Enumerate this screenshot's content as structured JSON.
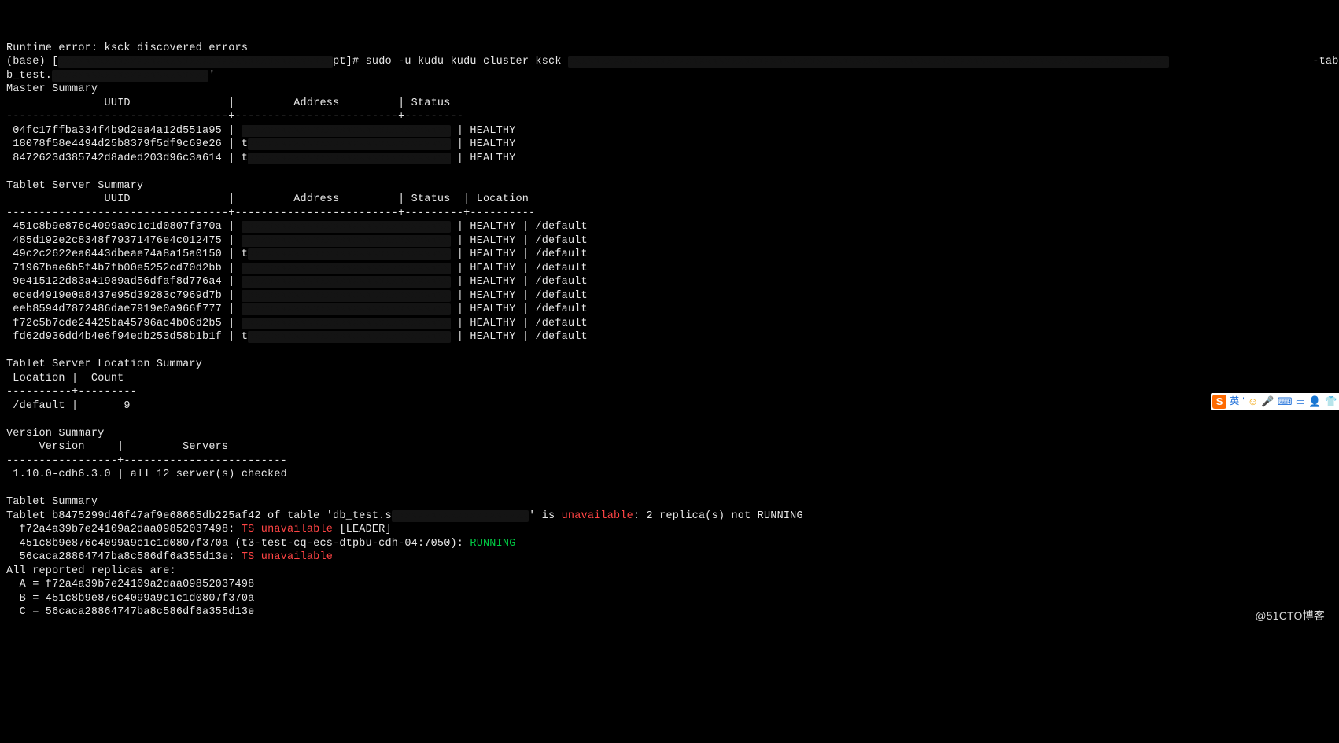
{
  "line0": "Runtime error: ksck discovered errors",
  "prompt": {
    "prefix": "(base) [",
    "host_redacted": "xxxxxxxxxxxxxxxxxxxxxxxxxxxxxxxxxxxxxxxxxx",
    "suffix": "pt]# ",
    "cmd": "sudo -u kudu kudu cluster ksck ",
    "args_redacted": "xxxxxxxxxxxxxxxxxxxxxxxxxxxxxxxxxxxxxxxxxxxxxxxxxxxxxxxxxxxxxxxxxxxxxxxxxxxxxxxxxxxxxxxxxxxx",
    "tail": "                      -tables='d",
    "line2a": "b_test.",
    "line2_redacted": "xxxxxxxxxxxxxxxxxxxxxxxx",
    "line2b": "'"
  },
  "master": {
    "title": "Master Summary",
    "header": "               UUID               |         Address         | Status",
    "sep": "----------------------------------+-------------------------+---------",
    "rows": [
      {
        "uuid": " 04fc17ffba334f4b9d2ea4a12d551a95 | ",
        "addr": "xxxxxxxxxxxxxxxxxxxxxxxxxxxxxxxx",
        "tail": " | HEALTHY"
      },
      {
        "uuid": " 18078f58e4494d25b8379f5df9c69e26 | t",
        "addr": "xxxxxxxxxxxxxxxxxxxxxxxxxxxxxxx",
        "tail": " | HEALTHY"
      },
      {
        "uuid": " 8472623d385742d8aded203d96c3a614 | t",
        "addr": "xxxxxxxxxxxxxxxxxxxxxxxxxxxxxxx",
        "tail": " | HEALTHY"
      }
    ]
  },
  "tserver": {
    "title": "Tablet Server Summary",
    "header": "               UUID               |         Address         | Status  | Location",
    "sep": "----------------------------------+-------------------------+---------+----------",
    "rows": [
      {
        "uuid": " 451c8b9e876c4099a9c1c1d0807f370a | ",
        "addr": "xxxxxxxxxxxxxxxxxxxxxxxxxxxxxxxx",
        "tail": " | HEALTHY | /default"
      },
      {
        "uuid": " 485d192e2c8348f79371476e4c012475 | ",
        "addr": "xxxxxxxxxxxxxxxxxxxxxxxxxxxxxxxx",
        "tail": " | HEALTHY | /default"
      },
      {
        "uuid": " 49c2c2622ea0443dbeae74a8a15a0150 | t",
        "addr": "xxxxxxxxxxxxxxxxxxxxxxxxxxxxxxx",
        "tail": " | HEALTHY | /default"
      },
      {
        "uuid": " 71967bae6b5f4b7fb00e5252cd70d2bb | ",
        "addr": "xxxxxxxxxxxxxxxxxxxxxxxxxxxxxxxx",
        "tail": " | HEALTHY | /default"
      },
      {
        "uuid": " 9e415122d83a41989ad56dfaf8d776a4 | ",
        "addr": "xxxxxxxxxxxxxxxxxxxxxxxxxxxxxxxx",
        "tail": " | HEALTHY | /default"
      },
      {
        "uuid": " eced4919e0a8437e95d39283c7969d7b | ",
        "addr": "xxxxxxxxxxxxxxxxxxxxxxxxxxxxxxxx",
        "tail": " | HEALTHY | /default"
      },
      {
        "uuid": " eeb8594d7872486dae7919e0a966f777 | ",
        "addr": "xxxxxxxxxxxxxxxxxxxxxxxxxxxxxxxx",
        "tail": " | HEALTHY | /default"
      },
      {
        "uuid": " f72c5b7cde24425ba45796ac4b06d2b5 | ",
        "addr": "xxxxxxxxxxxxxxxxxxxxxxxxxxxxxxxx",
        "tail": " | HEALTHY | /default"
      },
      {
        "uuid": " fd62d936dd4b4e6f94edb253d58b1b1f | t",
        "addr": "xxxxxxxxxxxxxxxxxxxxxxxxxxxxxxx",
        "tail": " | HEALTHY | /default"
      }
    ]
  },
  "location": {
    "title": "Tablet Server Location Summary",
    "header": " Location |  Count",
    "sep": "----------+---------",
    "row": " /default |       9"
  },
  "version": {
    "title": "Version Summary",
    "header": "     Version     |         Servers",
    "sep": "-----------------+-------------------------",
    "row": " 1.10.0-cdh6.3.0 | all 12 server(s) checked"
  },
  "tablet": {
    "title": "Tablet Summary",
    "l1a": "Tablet b8475299d46f47af9e68665db225af42 of table 'db_test.s",
    "l1_redacted": "xxxxxxxxxxxxxxxxxxxxx",
    "l1b": "' is ",
    "l1_unavailable": "unavailable",
    "l1c": ": 2 replica(s) not RUNNING",
    "l2a": "  f72a4a39b7e24109a2daa09852037498: ",
    "l2_ts": "TS unavailable",
    "l2b": " [LEADER]",
    "l3a": "  451c8b9e876c4099a9c1c1d0807f370a (t3-test-cq-ecs-dtpbu-cdh-04:7050): ",
    "l3_running": "RUNNING",
    "l4a": "  56caca28864747ba8c586df6a355d13e: ",
    "l4_ts": "TS unavailable",
    "rep_title": "All reported replicas are:",
    "repA": "  A = f72a4a39b7e24109a2daa09852037498",
    "repB": "  B = 451c8b9e876c4099a9c1c1d0807f370a",
    "repC": "  C = 56caca28864747ba8c586df6a355d13e"
  },
  "ime": {
    "lang": "英",
    "comma": "'",
    "icons": {
      "smile": "☺",
      "mic": "🎤",
      "keyb": "⌨",
      "screen": "▭",
      "person": "👤",
      "shirt": "👕"
    }
  },
  "watermark": "@51CTO博客"
}
